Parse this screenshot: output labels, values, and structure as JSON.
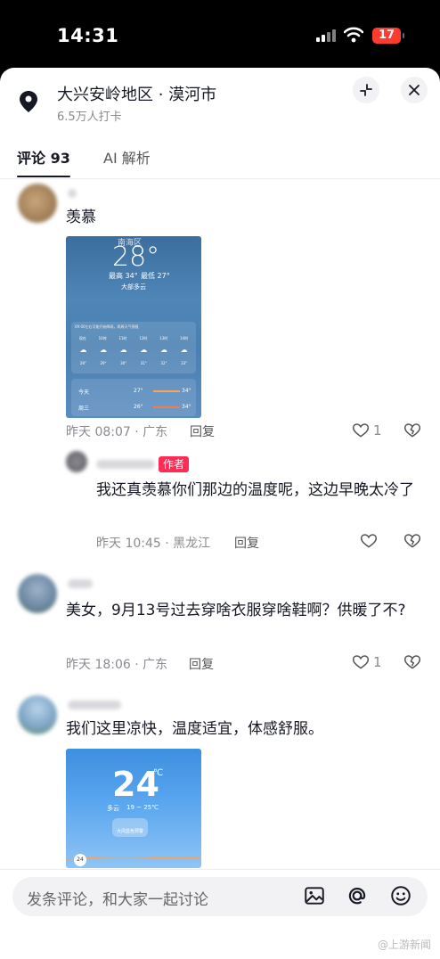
{
  "status": {
    "time": "14:31",
    "battery": "17"
  },
  "header": {
    "location": "大兴安岭地区 · 漠河市",
    "checkins": "6.5万人打卡"
  },
  "tabs": [
    {
      "label": "评论 93"
    },
    {
      "label": "AI 解析"
    }
  ],
  "comments": [
    {
      "text": "羡慕",
      "time": "昨天 08:07 · 广东",
      "reply": "回复",
      "likes": "1",
      "image": {
        "city": "南海区",
        "temp": "28°",
        "hi": "最高 34°",
        "lo": "最低 27°",
        "cond": "大部多云",
        "note": "09:00左右可能开始降雨，两周天气预报",
        "hours": [
          "现在",
          "10时",
          "11时",
          "12时",
          "13时",
          "14时"
        ],
        "htemps": [
          "28°",
          "29°",
          "30°",
          "31°",
          "32°",
          "33°"
        ],
        "days": [
          {
            "d": "今天",
            "lo": "27°",
            "hi": "34°"
          },
          {
            "d": "周三",
            "lo": "26°",
            "hi": "34°"
          }
        ]
      }
    }
  ],
  "author_reply": {
    "badge": "作者",
    "text": "我还真羡慕你们那边的温度呢，这边早晚太冷了",
    "time": "昨天 10:45 · 黑龙江",
    "reply": "回复"
  },
  "comment2": {
    "text": "美女，9月13号过去穿啥衣服穿啥鞋啊？供暖了不?",
    "time": "昨天 18:06 · 广东",
    "reply": "回复",
    "likes": "1"
  },
  "comment3": {
    "text": "我们这里凉快，温度适宜，体感舒服。",
    "image": {
      "temp": "24",
      "unit": "℃",
      "cond": "多云",
      "range": "19 ~ 25℃",
      "tag": "大风蓝色预警",
      "badge": "24"
    }
  },
  "input": {
    "placeholder": "发条评论，和大家一起讨论"
  },
  "watermark": "@上游新闻",
  "colors": {
    "accent": "#fe2c55",
    "battery": "#ff3b30"
  }
}
